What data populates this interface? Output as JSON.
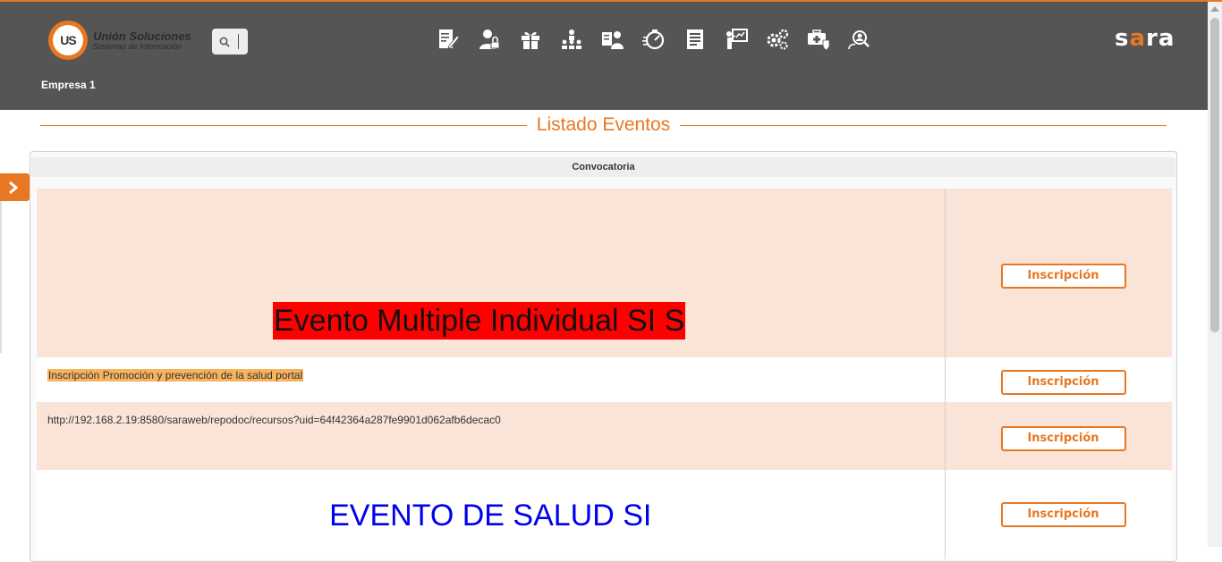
{
  "header": {
    "logo_name": "Unión Soluciones",
    "logo_tagline": "Sistemas de Información",
    "logo_badge": "US",
    "company": "Empresa 1",
    "brand_part1": "s",
    "brand_part2": "a",
    "brand_part3": "ra",
    "icons": [
      "edit-document-icon",
      "user-lock-icon",
      "gift-icon",
      "organization-icon",
      "worker-card-icon",
      "timer-icon",
      "list-document-icon",
      "presentation-icon",
      "gears-icon",
      "medical-kit-icon",
      "search-users-icon"
    ],
    "accent_color": "#e87722"
  },
  "page": {
    "title": "Listado Eventos"
  },
  "table": {
    "header": "Convocatoria",
    "rows": [
      {
        "text": "Evento Multiple Individual SI S",
        "button": "Inscripción"
      },
      {
        "text": "Inscripción Promoción y prevención de la salud portal",
        "button": "Inscripción"
      },
      {
        "text": "http://192.168.2.19:8580/saraweb/repodoc/recursos?uid=64f42364a287fe9901d062afb6decac0",
        "button": "Inscripción"
      },
      {
        "text": "EVENTO DE SALUD SI",
        "button": "Inscripción"
      }
    ]
  }
}
